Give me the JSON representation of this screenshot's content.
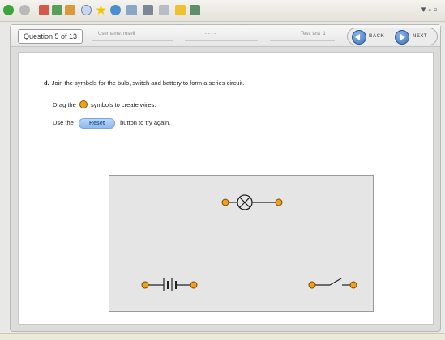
{
  "header": {
    "question_label": "Question 5 of 13",
    "username_label": "Username: rosell",
    "middle_label": "- - - -",
    "test_label": "Test: test_1",
    "back_label": "BACK",
    "next_label": "NEXT"
  },
  "question": {
    "letter": "d.",
    "text": "Join the symbols for the bulb, switch and battery to form a series circuit.",
    "drag_before": "Drag the",
    "drag_after": "symbols to create wires.",
    "use_before": "Use the",
    "reset_label": "Reset",
    "use_after": "button to try again."
  },
  "colors": {
    "connector": "#f0a020",
    "board_bg": "#e5e5e5",
    "accent": "#3f71b8"
  }
}
